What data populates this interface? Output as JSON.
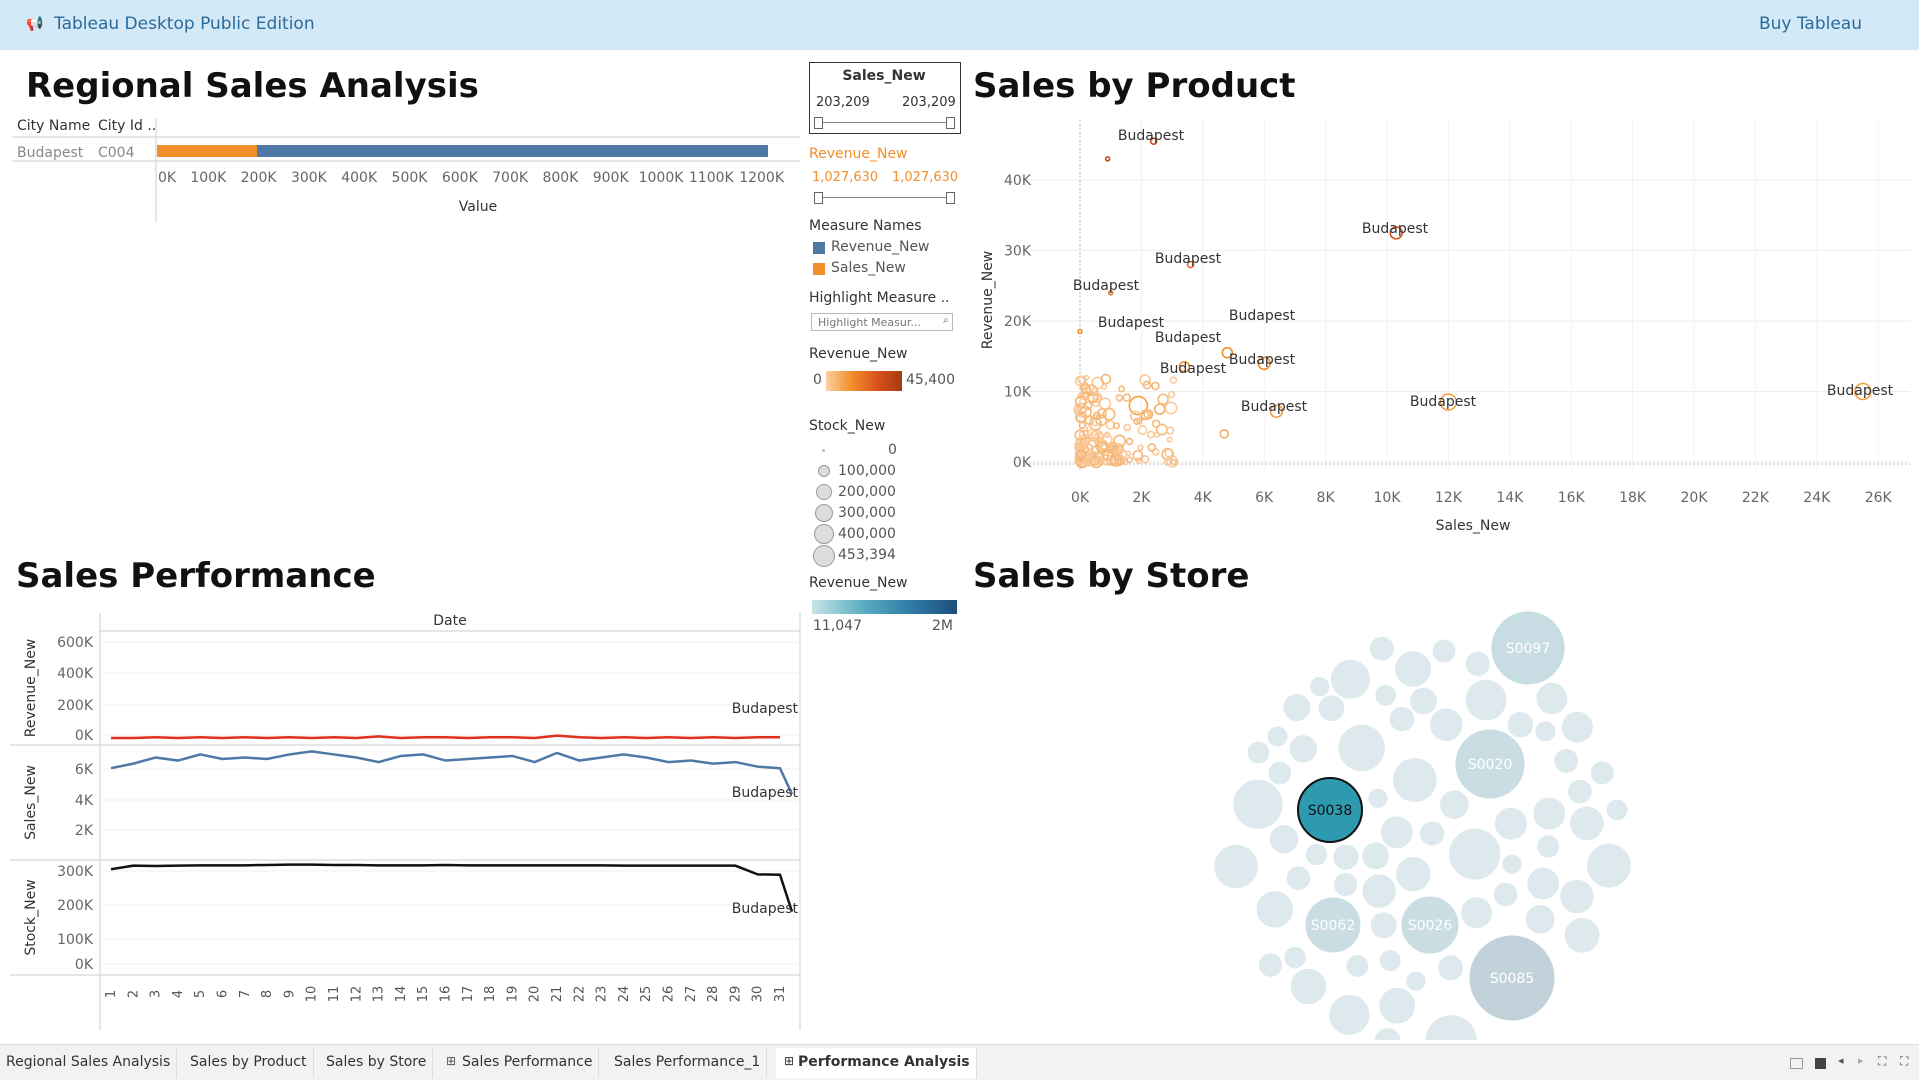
{
  "app": {
    "title": "Tableau Desktop Public Edition",
    "buy": "Buy Tableau"
  },
  "titles": {
    "regional": "Regional Sales Analysis",
    "product": "Sales by Product",
    "performance": "Sales Performance",
    "store": "Sales by Store"
  },
  "regional": {
    "col1": "City Name",
    "col2": "City Id ..",
    "city": "Budapest",
    "city_id": "C004",
    "xlabel": "Value",
    "ticks": [
      "0K",
      "100K",
      "200K",
      "300K",
      "400K",
      "500K",
      "600K",
      "700K",
      "800K",
      "900K",
      "1000K",
      "1100K",
      "1200K"
    ]
  },
  "legend": {
    "sales_filter": {
      "title": "Sales_New",
      "min": "203,209",
      "max": "203,209"
    },
    "revenue_filter": {
      "title": "Revenue_New",
      "min": "1,027,630",
      "max": "1,027,630"
    },
    "measure_names": {
      "title": "Measure Names",
      "items": [
        "Revenue_New",
        "Sales_New"
      ]
    },
    "highlight": {
      "title": "Highlight Measure ..",
      "placeholder": "Highlight Measur..."
    },
    "revenue_color": {
      "title": "Revenue_New",
      "min": "0",
      "max": "45,400"
    },
    "stock": {
      "title": "Stock_New",
      "items": [
        "0",
        "100,000",
        "200,000",
        "300,000",
        "400,000",
        "453,394"
      ]
    },
    "revenue_color2": {
      "title": "Revenue_New",
      "min": "11,047",
      "max": "2M"
    }
  },
  "scatter": {
    "xlabel": "Sales_New",
    "ylabel": "Revenue_New",
    "xticks": [
      "0K",
      "2K",
      "4K",
      "6K",
      "8K",
      "10K",
      "12K",
      "14K",
      "16K",
      "18K",
      "20K",
      "22K",
      "24K",
      "26K"
    ],
    "yticks": [
      "0K",
      "10K",
      "20K",
      "30K",
      "40K"
    ],
    "label": "Budapest"
  },
  "performance": {
    "top": "Date",
    "rows": [
      {
        "name": "Revenue_New",
        "ticks": [
          "0K",
          "200K",
          "400K",
          "600K"
        ]
      },
      {
        "name": "Sales_New",
        "ticks": [
          "2K",
          "4K",
          "6K"
        ]
      },
      {
        "name": "Stock_New",
        "ticks": [
          "0K",
          "100K",
          "200K",
          "300K"
        ]
      }
    ],
    "label": "Budapest",
    "days": [
      "1",
      "2",
      "3",
      "4",
      "5",
      "6",
      "7",
      "8",
      "9",
      "10",
      "11",
      "12",
      "13",
      "14",
      "15",
      "16",
      "17",
      "18",
      "19",
      "20",
      "21",
      "22",
      "23",
      "24",
      "25",
      "26",
      "27",
      "28",
      "29",
      "30",
      "31"
    ]
  },
  "store": {
    "labels": [
      "S0097",
      "S0020",
      "S0038",
      "S0062",
      "S0026",
      "S0085"
    ]
  },
  "tabs": [
    "Regional Sales Analysis",
    "Sales by Product",
    "Sales by Store",
    "Sales Performance",
    "Sales Performance_1",
    "Performance Analysis"
  ],
  "colors": {
    "blue": "#4e79a7",
    "orange": "#f28e2b",
    "red": "#e03020",
    "teal": "#3a9ab0"
  }
}
